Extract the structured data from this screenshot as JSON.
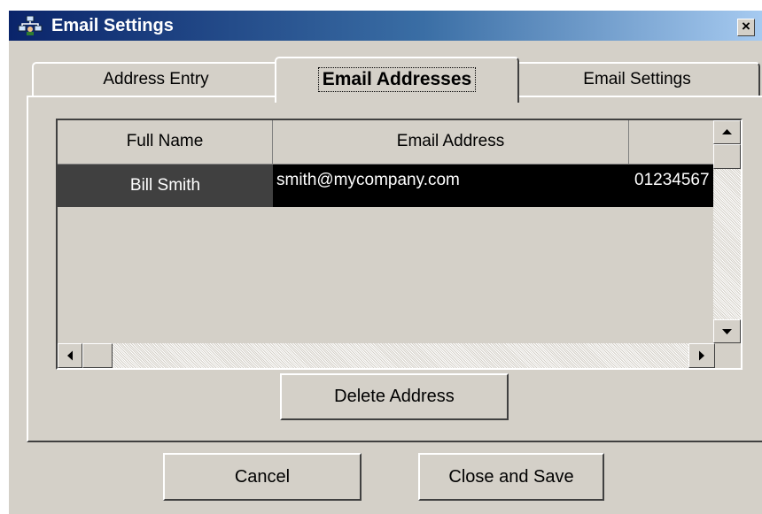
{
  "window": {
    "title": "Email Settings",
    "close_glyph": "×",
    "app_icon": "network-users-icon"
  },
  "tabs": [
    {
      "label": "Address Entry",
      "active": false
    },
    {
      "label": "Email Addresses",
      "active": true
    },
    {
      "label": "Email Settings",
      "active": false
    }
  ],
  "grid": {
    "columns": [
      "Full Name",
      "Email Address"
    ],
    "rows": [
      {
        "full_name": "Bill Smith",
        "email": "smith@mycompany.com",
        "phone": "01234567"
      }
    ],
    "selected_row": 0
  },
  "buttons": {
    "delete": "Delete Address",
    "cancel": "Cancel",
    "close_save": "Close and Save"
  },
  "colors": {
    "title_gradient_start": "#0a246a",
    "title_gradient_end": "#a6caf0",
    "face": "#d4d0c8",
    "selected_row": "#000000"
  }
}
